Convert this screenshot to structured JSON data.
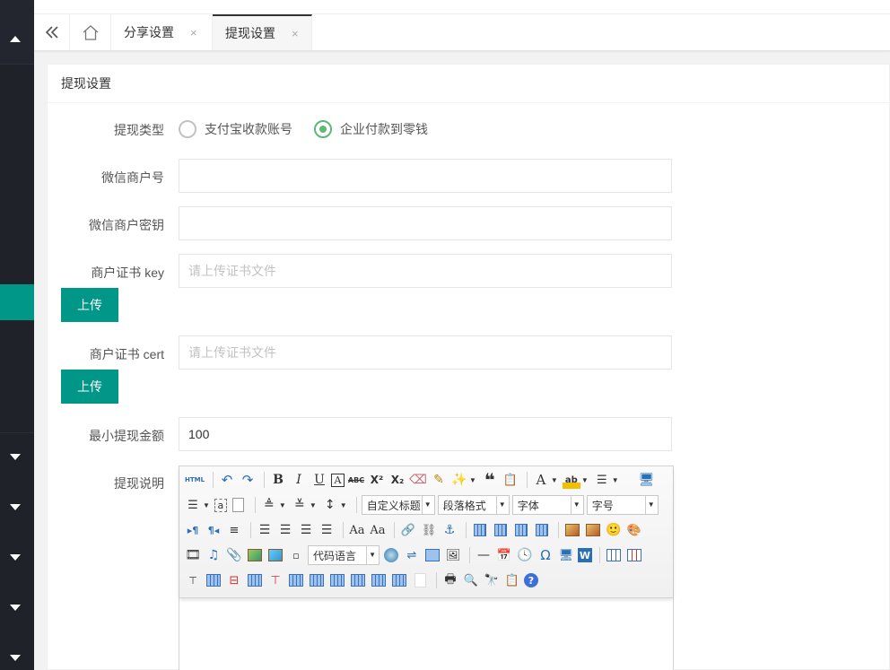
{
  "tabs": {
    "items": [
      {
        "label": "分享设置",
        "close": "×"
      },
      {
        "label": "提现设置",
        "close": "×"
      }
    ]
  },
  "card": {
    "title": "提现设置"
  },
  "form": {
    "withdraw_type": {
      "label": "提现类型",
      "options": [
        {
          "label": "支付宝收款账号",
          "checked": false
        },
        {
          "label": "企业付款到零钱",
          "checked": true
        }
      ]
    },
    "merchant_no": {
      "label": "微信商户号",
      "value": ""
    },
    "merchant_secret": {
      "label": "微信商户密钥",
      "value": ""
    },
    "cert_key": {
      "label": "商户证书 key",
      "placeholder": "请上传证书文件",
      "upload_label": "上传"
    },
    "cert_cert": {
      "label": "商户证书 cert",
      "placeholder": "请上传证书文件",
      "upload_label": "上传"
    },
    "min_amount": {
      "label": "最小提现金额",
      "value": "100"
    },
    "description": {
      "label": "提现说明"
    }
  },
  "editor": {
    "html_label": "HTML",
    "custom_heading": "自定义标题",
    "paragraph_format": "段落格式",
    "font_family": "字体",
    "font_size": "字号",
    "code_language": "代码语言"
  },
  "colors": {
    "accent": "#009688",
    "radio_checked": "#5fb878",
    "sidebar": "#20222a"
  }
}
